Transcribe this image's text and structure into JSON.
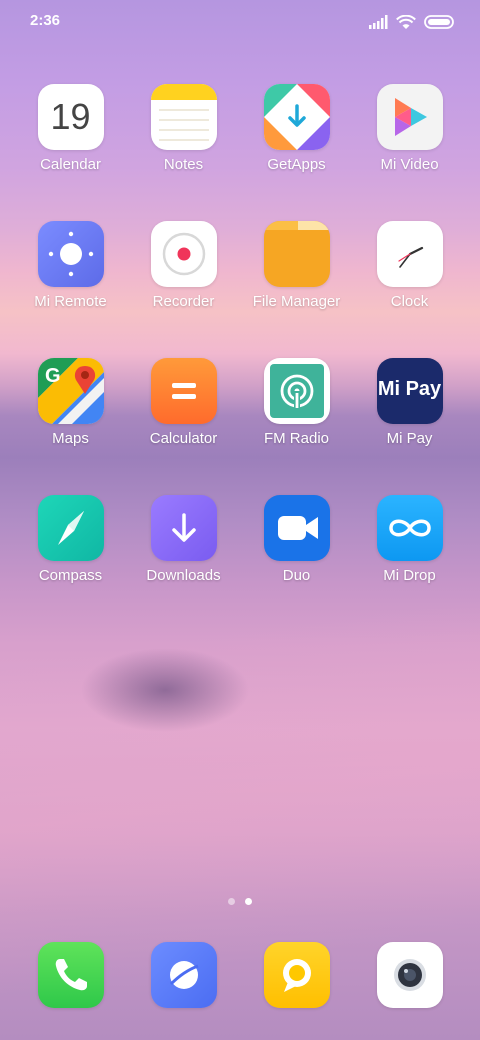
{
  "status_bar": {
    "time": "2:36",
    "icons": [
      "signal-icon",
      "wifi-icon",
      "battery-icon"
    ]
  },
  "calendar_date": "19",
  "mipay_logo": "Mi Pay",
  "apps": [
    {
      "label": "Calendar",
      "icon": "calendar-icon"
    },
    {
      "label": "Notes",
      "icon": "notes-icon"
    },
    {
      "label": "GetApps",
      "icon": "getapps-icon"
    },
    {
      "label": "Mi Video",
      "icon": "mi-video-icon"
    },
    {
      "label": "Mi Remote",
      "icon": "mi-remote-icon"
    },
    {
      "label": "Recorder",
      "icon": "recorder-icon"
    },
    {
      "label": "File Manager",
      "icon": "file-manager-icon"
    },
    {
      "label": "Clock",
      "icon": "clock-icon"
    },
    {
      "label": "Maps",
      "icon": "maps-icon"
    },
    {
      "label": "Calculator",
      "icon": "calculator-icon"
    },
    {
      "label": "FM Radio",
      "icon": "fm-radio-icon"
    },
    {
      "label": "Mi Pay",
      "icon": "mi-pay-icon"
    },
    {
      "label": "Compass",
      "icon": "compass-icon"
    },
    {
      "label": "Downloads",
      "icon": "downloads-icon"
    },
    {
      "label": "Duo",
      "icon": "duo-icon"
    },
    {
      "label": "Mi Drop",
      "icon": "mi-drop-icon"
    }
  ],
  "page_indicator": {
    "pages": 2,
    "current": 2
  },
  "dock": [
    {
      "icon": "phone-icon"
    },
    {
      "icon": "browser-icon"
    },
    {
      "icon": "messaging-icon"
    },
    {
      "icon": "camera-icon"
    }
  ]
}
